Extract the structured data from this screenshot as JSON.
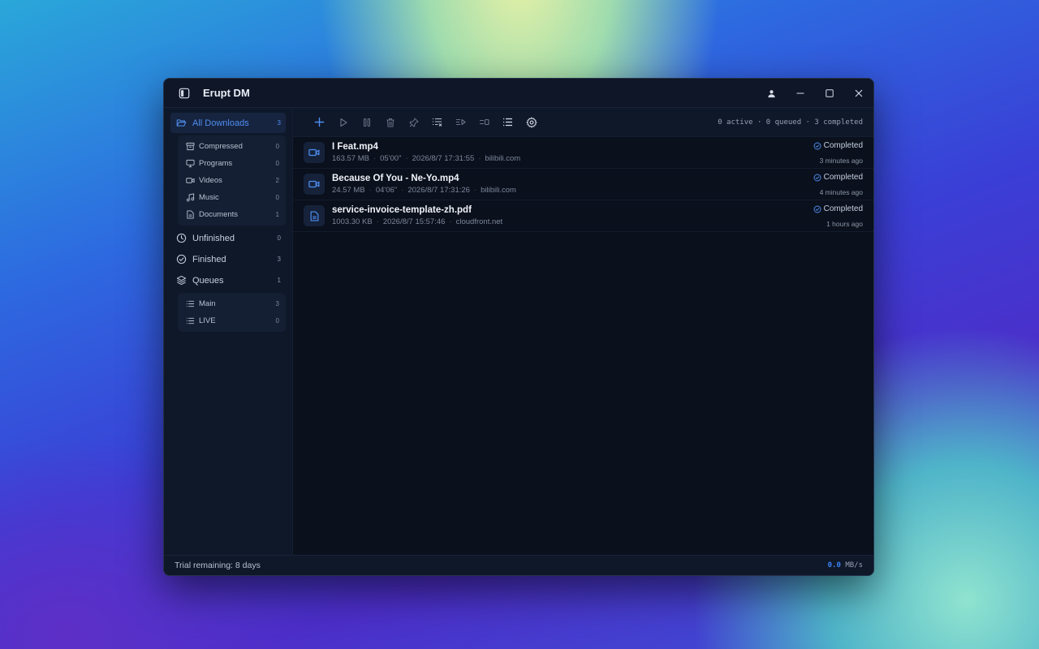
{
  "app": {
    "title": "Erupt DM"
  },
  "sidebar": {
    "all_downloads": {
      "label": "All Downloads",
      "count": "3"
    },
    "categories": [
      {
        "label": "Compressed",
        "count": "0",
        "icon": "archive-icon"
      },
      {
        "label": "Programs",
        "count": "0",
        "icon": "monitor-icon"
      },
      {
        "label": "Videos",
        "count": "2",
        "icon": "video-icon"
      },
      {
        "label": "Music",
        "count": "0",
        "icon": "music-icon"
      },
      {
        "label": "Documents",
        "count": "1",
        "icon": "document-icon"
      }
    ],
    "unfinished": {
      "label": "Unfinished",
      "count": "0"
    },
    "finished": {
      "label": "Finished",
      "count": "3"
    },
    "queues": {
      "label": "Queues",
      "count": "1"
    },
    "queue_items": [
      {
        "label": "Main",
        "count": "3"
      },
      {
        "label": "LIVE",
        "count": "0"
      }
    ]
  },
  "toolbar": {
    "summary": "0 active · 0 queued · 3 completed",
    "buttons": [
      "add-icon",
      "play-icon",
      "pause-icon",
      "trash-icon",
      "pin-icon",
      "clear-list-icon",
      "move-queue-icon",
      "toggle-icon",
      "list-icon",
      "gear-icon"
    ]
  },
  "downloads": [
    {
      "name": "I Feat.mp4",
      "size": "163.57 MB",
      "duration": "05'00\"",
      "date": "2026/8/7 17:31:55",
      "source": "bilibili.com",
      "status": "Completed",
      "time_ago": "3 minutes ago",
      "icon": "video-icon"
    },
    {
      "name": "Because Of You - Ne-Yo.mp4",
      "size": "24.57 MB",
      "duration": "04'06\"",
      "date": "2026/8/7 17:31:26",
      "source": "bilibili.com",
      "status": "Completed",
      "time_ago": "4 minutes ago",
      "icon": "video-icon"
    },
    {
      "name": "service-invoice-template-zh.pdf",
      "size": "1003.30 KB",
      "date": "2026/8/7 15:57:46",
      "source": "cloudfront.net",
      "status": "Completed",
      "time_ago": "1 hours ago",
      "icon": "document-icon"
    }
  ],
  "statusbar": {
    "trial": "Trial remaining: 8 days",
    "speed_value": "0.0",
    "speed_unit": "MB/s"
  },
  "colors": {
    "accent": "#3b82f6",
    "window_bg": "#0b1220",
    "sidebar_bg": "#0f1829"
  }
}
